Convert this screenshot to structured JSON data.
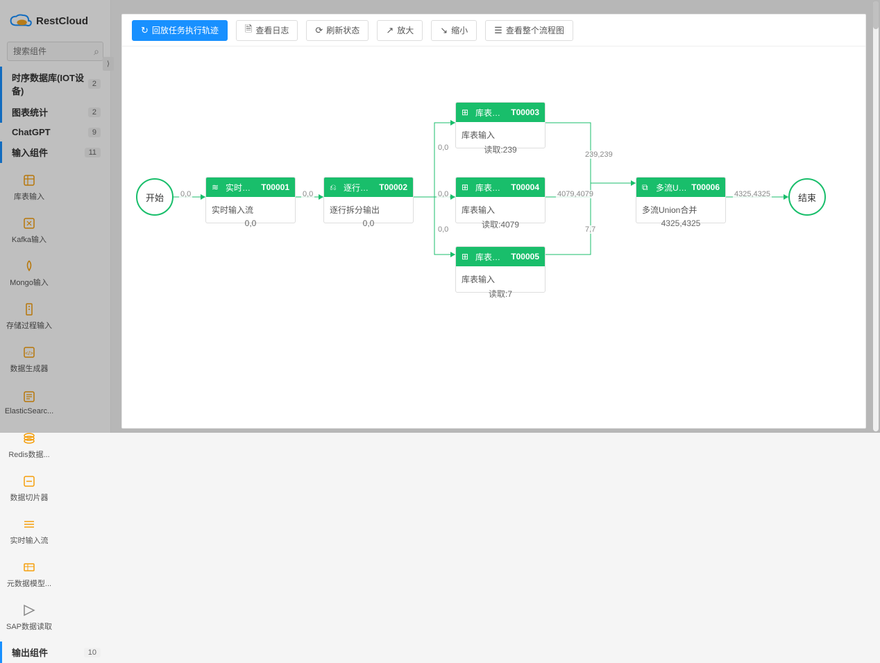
{
  "brand": "RestCloud",
  "search": {
    "placeholder": "搜索组件"
  },
  "categories": [
    {
      "label": "时序数据库(IOT设备)",
      "count": 2,
      "active": true
    },
    {
      "label": "图表统计",
      "count": 2,
      "active": true
    },
    {
      "label": "ChatGPT",
      "count": 9,
      "active": false
    },
    {
      "label": "输入组件",
      "count": 11,
      "active": true
    }
  ],
  "input_components": [
    {
      "label": "库表输入"
    },
    {
      "label": "Kafka输入"
    },
    {
      "label": "Mongo输入"
    },
    {
      "label": "存储过程输入"
    },
    {
      "label": "数据生成器"
    },
    {
      "label": "ElasticSearc..."
    },
    {
      "label": "Redis数据..."
    },
    {
      "label": "数据切片器"
    },
    {
      "label": "实时输入流"
    },
    {
      "label": "元数据模型..."
    },
    {
      "label": "SAP数据读取"
    }
  ],
  "output_category": {
    "label": "输出组件",
    "count": 10
  },
  "toolbar": {
    "replay": "回放任务执行轨迹",
    "logs": "查看日志",
    "refresh": "刷新状态",
    "zoom_in": "放大",
    "zoom_out": "缩小",
    "view_all": "查看整个流程图"
  },
  "nodes": {
    "start": {
      "label": "开始"
    },
    "end": {
      "label": "结束"
    },
    "t1": {
      "title": "实时输入流",
      "id": "T00001",
      "body": "实时输入流",
      "footer": "0,0"
    },
    "t2": {
      "title": "逐行拆分输...",
      "id": "T00002",
      "body": "逐行拆分输出",
      "footer": "0,0"
    },
    "t3": {
      "title": "库表输入",
      "id": "T00003",
      "body": "库表输入",
      "subtext": "读取:239"
    },
    "t4": {
      "title": "库表输入",
      "id": "T00004",
      "body": "库表输入",
      "subtext": "读取:4079"
    },
    "t5": {
      "title": "库表输入",
      "id": "T00005",
      "body": "库表输入",
      "subtext": "读取:7"
    },
    "t6": {
      "title": "多流Union...",
      "id": "T00006",
      "body": "多流Union合并",
      "footer": "4325,4325"
    }
  },
  "edges": {
    "e_start_t1": "0,0",
    "e_t1_t2": "0,0",
    "e_t2_t3": "0,0",
    "e_t2_t4": "0,0",
    "e_t2_t5": "0,0",
    "e_t3_t6": "239,239",
    "e_t4_t6": "4079,4079",
    "e_t5_t6": "7,7",
    "e_t6_end": "4325,4325"
  }
}
